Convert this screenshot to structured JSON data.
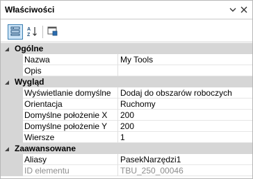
{
  "panel": {
    "title": "Właściwości"
  },
  "toolbar": {
    "buttons": [
      {
        "icon": "categorized-icon",
        "active": true
      },
      {
        "icon": "alphabetical-sort-icon",
        "active": false
      },
      {
        "icon": "property-pages-icon",
        "active": false
      }
    ]
  },
  "grid": {
    "categories": [
      {
        "label": "Ogólne",
        "properties": [
          {
            "name": "Nazwa",
            "value": "My Tools"
          },
          {
            "name": "Opis",
            "value": ""
          }
        ]
      },
      {
        "label": "Wygląd",
        "properties": [
          {
            "name": "Wyświetlanie domyślne",
            "value": "Dodaj do obszarów roboczych"
          },
          {
            "name": "Orientacja",
            "value": "Ruchomy"
          },
          {
            "name": "Domyślne położenie X",
            "value": "200"
          },
          {
            "name": "Domyślne położenie Y",
            "value": "200"
          },
          {
            "name": "Wiersze",
            "value": "1"
          }
        ]
      },
      {
        "label": "Zaawansowane",
        "properties": [
          {
            "name": "Aliasy",
            "value": "PasekNarzędzi1"
          },
          {
            "name": "ID elementu",
            "value": "TBU_250_00046",
            "readonly": true
          }
        ]
      }
    ]
  }
}
